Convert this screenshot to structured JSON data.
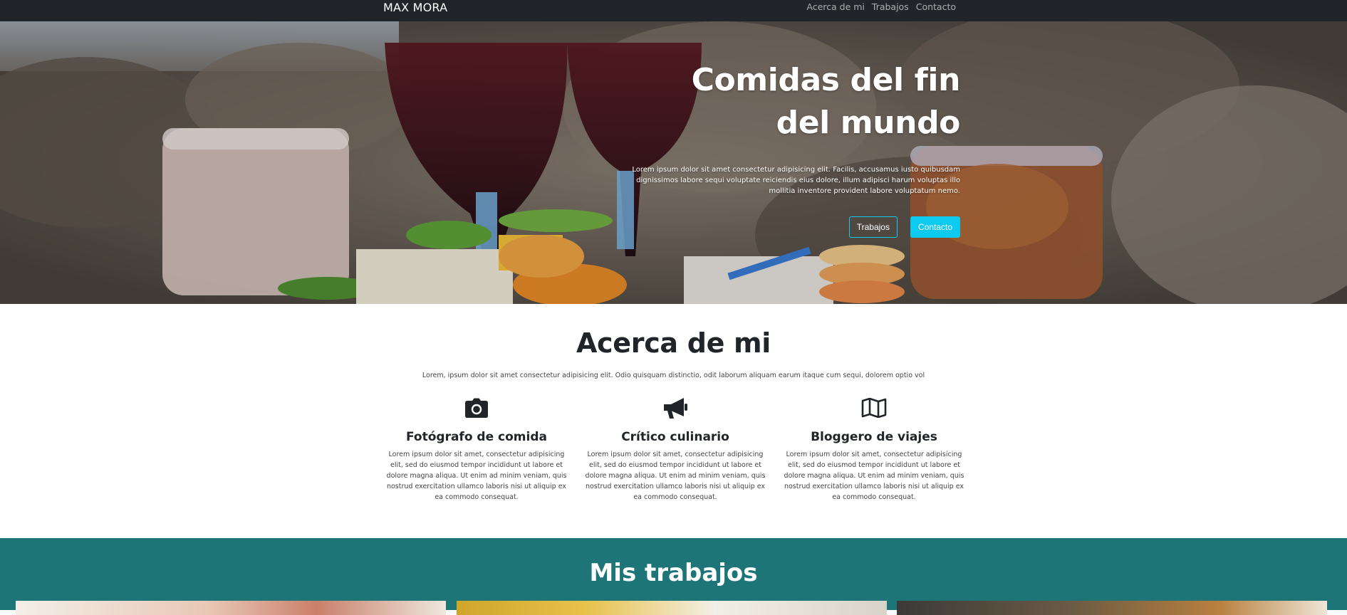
{
  "navbar": {
    "brand": "MAX MORA",
    "links": [
      "Acerca de mi",
      "Trabajos",
      "Contacto"
    ]
  },
  "hero": {
    "title_line1": "Comidas del fin",
    "title_line2": "del mundo",
    "lead": "Lorem ipsum dolor sit amet consectetur adipisicing elit. Facilis, accusamus iusto quibusdam dignissimos labore sequi voluptate reiciendis eius dolore, illum adipisci harum voluptas illo mollitia inventore provident labore voluptatum nemo.",
    "buttons": {
      "works": "Trabajos",
      "contact": "Contacto"
    }
  },
  "about": {
    "title": "Acerca de mi",
    "lead": "Lorem, ipsum dolor sit amet consectetur adipisicing elit. Odio quisquam distinctio, odit laborum aliquam earum itaque cum sequi, dolorem optio vol",
    "features": [
      {
        "icon": "camera-icon",
        "title": "Fotógrafo de comida",
        "text": "Lorem ipsum dolor sit amet, consectetur adipisicing elit, sed do eiusmod tempor incididunt ut labore et dolore magna aliqua. Ut enim ad minim veniam, quis nostrud exercitation ullamco laboris nisi ut aliquip ex ea commodo consequat."
      },
      {
        "icon": "megaphone-icon",
        "title": "Crítico culinario",
        "text": "Lorem ipsum dolor sit amet, consectetur adipisicing elit, sed do eiusmod tempor incididunt ut labore et dolore magna aliqua. Ut enim ad minim veniam, quis nostrud exercitation ullamco laboris nisi ut aliquip ex ea commodo consequat."
      },
      {
        "icon": "map-icon",
        "title": "Bloggero de viajes",
        "text": "Lorem ipsum dolor sit amet, consectetur adipisicing elit, sed do eiusmod tempor incididunt ut labore et dolore magna aliqua. Ut enim ad minim veniam, quis nostrud exercitation ullamco laboris nisi ut aliquip ex ea commodo consequat."
      }
    ]
  },
  "works": {
    "title": "Mis trabajos"
  },
  "colors": {
    "navbar_bg": "#212529",
    "accent": "#0dcaf0",
    "works_bg": "#1d7578"
  }
}
